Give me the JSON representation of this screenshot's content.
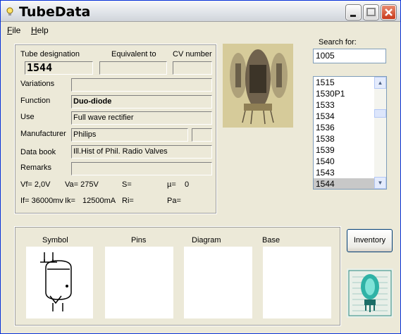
{
  "window": {
    "title": "TubeData"
  },
  "menu": {
    "file": "File",
    "help": "Help"
  },
  "search": {
    "label": "Search for:",
    "value": "1005"
  },
  "tube_list": [
    "1515",
    "1530P1",
    "1533",
    "1534",
    "1536",
    "1538",
    "1539",
    "1540",
    "1543",
    "1544"
  ],
  "tube_list_selected": "1544",
  "fields": {
    "designation_label": "Tube designation",
    "equivalent_label": "Equivalent to",
    "cv_label": "CV number",
    "designation": "1544",
    "equivalent": "",
    "cv": "",
    "variations_label": "Variations",
    "variations": "",
    "function_label": "Function",
    "function": "Duo-diode",
    "use_label": "Use",
    "use": "Full wave rectifier",
    "manufacturer_label": "Manufacturer",
    "manufacturer": "Philips",
    "manufacturer_extra": "",
    "databook_label": "Data book",
    "databook": "Ill.Hist of Phil. Radio Valves",
    "remarks_label": "Remarks",
    "remarks": ""
  },
  "params": {
    "vf": "Vf= 2,0V",
    "va": "Va= 275V",
    "s": "S=",
    "mu": "µ=",
    "mu_value": "0",
    "if": "If= 36000mv",
    "ik": "Ik=",
    "ik_value": "12500mA",
    "ri": "Ri=",
    "pa": "Pa="
  },
  "lower_panel": {
    "symbol": "Symbol",
    "pins": "Pins",
    "diagram": "Diagram",
    "base": "Base"
  },
  "inventory_button": "Inventory"
}
